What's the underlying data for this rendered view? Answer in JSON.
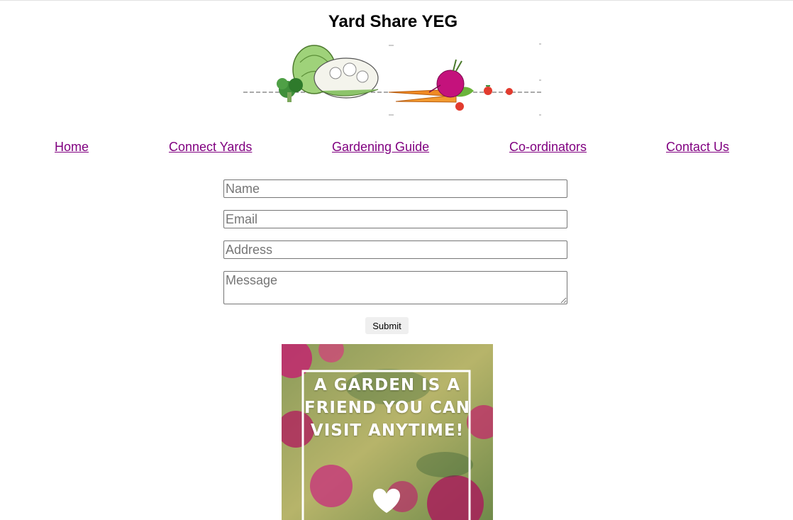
{
  "site": {
    "title": "Yard Share YEG"
  },
  "nav": {
    "items": [
      {
        "label": "Home"
      },
      {
        "label": "Connect Yards"
      },
      {
        "label": "Gardening Guide"
      },
      {
        "label": "Co-ordinators"
      },
      {
        "label": "Contact Us"
      }
    ],
    "link_color": "#800080"
  },
  "form": {
    "name_placeholder": "Name",
    "email_placeholder": "Email",
    "address_placeholder": "Address",
    "message_placeholder": "Message",
    "submit_label": "Submit"
  },
  "poster": {
    "lines": [
      "A GARDEN IS A",
      "FRIEND YOU CAN",
      "VISIT ANYTIME!"
    ],
    "icon": "heart-icon"
  },
  "banner": {
    "icon": "vegetables-illustration"
  }
}
